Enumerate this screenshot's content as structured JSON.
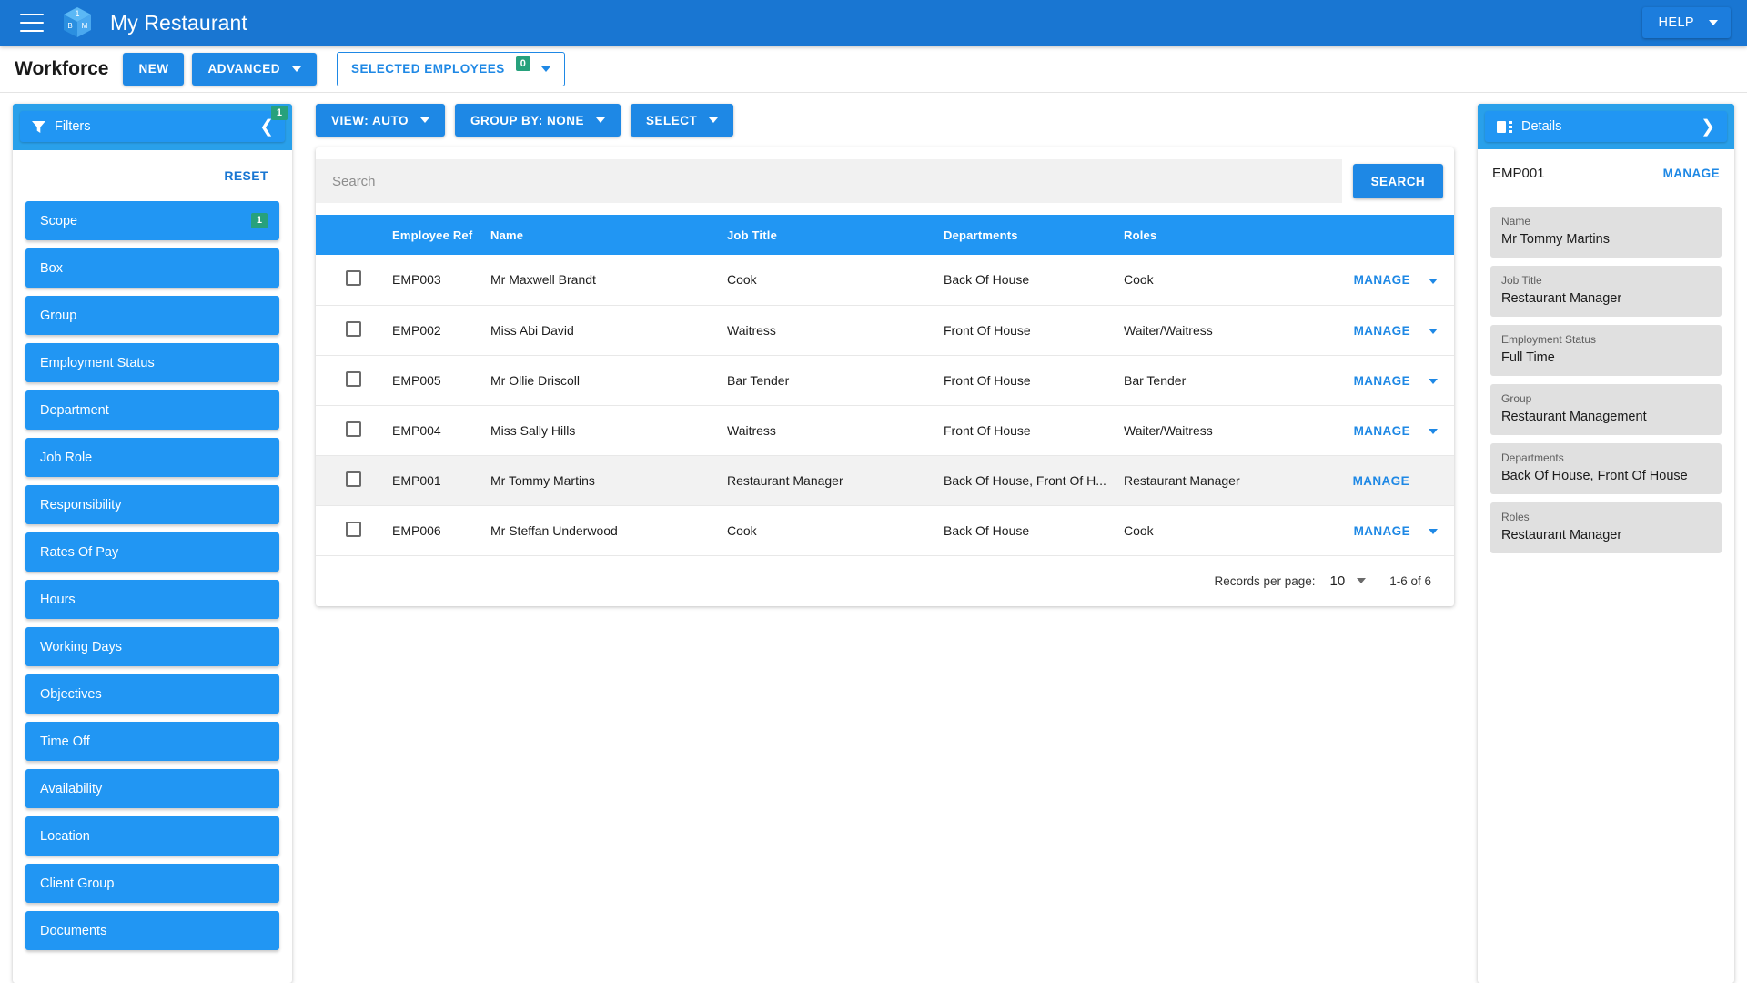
{
  "appbar": {
    "menu_icon": "hamburger-icon",
    "logo_icon": "brand-cube-logo",
    "logo_faces": {
      "top": "1",
      "left": "B",
      "right": "M"
    },
    "title": "My Restaurant",
    "help_label": "HELP"
  },
  "subbar": {
    "page_title": "Workforce",
    "new_label": "NEW",
    "advanced_label": "ADVANCED",
    "selected_employees_label": "SELECTED EMPLOYEES",
    "selected_employees_count": "0"
  },
  "filters": {
    "header_label": "Filters",
    "header_badge": "1",
    "reset_label": "RESET",
    "items": [
      {
        "label": "Scope",
        "badge": "1"
      },
      {
        "label": "Box",
        "badge": ""
      },
      {
        "label": "Group",
        "badge": ""
      },
      {
        "label": "Employment Status",
        "badge": ""
      },
      {
        "label": "Department",
        "badge": ""
      },
      {
        "label": "Job Role",
        "badge": ""
      },
      {
        "label": "Responsibility",
        "badge": ""
      },
      {
        "label": "Rates Of Pay",
        "badge": ""
      },
      {
        "label": "Hours",
        "badge": ""
      },
      {
        "label": "Working Days",
        "badge": ""
      },
      {
        "label": "Objectives",
        "badge": ""
      },
      {
        "label": "Time Off",
        "badge": ""
      },
      {
        "label": "Availability",
        "badge": ""
      },
      {
        "label": "Location",
        "badge": ""
      },
      {
        "label": "Client Group",
        "badge": ""
      },
      {
        "label": "Documents",
        "badge": ""
      }
    ]
  },
  "toolbar": {
    "view_label": "VIEW: AUTO",
    "group_by_label": "GROUP BY: NONE",
    "select_label": "SELECT"
  },
  "search": {
    "value": "",
    "placeholder": "Search",
    "button_label": "SEARCH"
  },
  "table": {
    "columns": [
      "Employee Ref",
      "Name",
      "Job Title",
      "Departments",
      "Roles"
    ],
    "action_label": "MANAGE",
    "rows": [
      {
        "ref": "EMP003",
        "name": "Mr Maxwell Brandt",
        "job": "Cook",
        "dept": "Back Of House",
        "roles": "Cook",
        "selected": false,
        "has_caret": true
      },
      {
        "ref": "EMP002",
        "name": "Miss Abi David",
        "job": "Waitress",
        "dept": "Front Of House",
        "roles": "Waiter/Waitress",
        "selected": false,
        "has_caret": true
      },
      {
        "ref": "EMP005",
        "name": "Mr Ollie Driscoll",
        "job": "Bar Tender",
        "dept": "Front Of House",
        "roles": "Bar Tender",
        "selected": false,
        "has_caret": true
      },
      {
        "ref": "EMP004",
        "name": "Miss Sally Hills",
        "job": "Waitress",
        "dept": "Front Of House",
        "roles": "Waiter/Waitress",
        "selected": false,
        "has_caret": true
      },
      {
        "ref": "EMP001",
        "name": "Mr Tommy Martins",
        "job": "Restaurant Manager",
        "dept": "Back Of House, Front Of H...",
        "roles": "Restaurant Manager",
        "selected": true,
        "has_caret": false
      },
      {
        "ref": "EMP006",
        "name": "Mr Steffan Underwood",
        "job": "Cook",
        "dept": "Back Of House",
        "roles": "Cook",
        "selected": false,
        "has_caret": true
      }
    ]
  },
  "pagination": {
    "records_per_page_label": "Records per page:",
    "records_per_page_value": "10",
    "range_label": "1-6 of 6"
  },
  "details": {
    "header_label": "Details",
    "employee_ref": "EMP001",
    "manage_label": "MANAGE",
    "fields": [
      {
        "label": "Name",
        "value": "Mr Tommy Martins"
      },
      {
        "label": "Job Title",
        "value": "Restaurant Manager"
      },
      {
        "label": "Employment Status",
        "value": "Full Time"
      },
      {
        "label": "Group",
        "value": "Restaurant Management"
      },
      {
        "label": "Departments",
        "value": "Back Of House, Front Of House"
      },
      {
        "label": "Roles",
        "value": "Restaurant Manager"
      }
    ]
  },
  "colors": {
    "appbar_blue": "#1976d2",
    "primary_blue": "#2196f3",
    "button_blue": "#1e88e5",
    "badge_green": "#27a17c",
    "panel_header_blue": "#29a0ea",
    "field_gray": "#e0e0e0"
  }
}
